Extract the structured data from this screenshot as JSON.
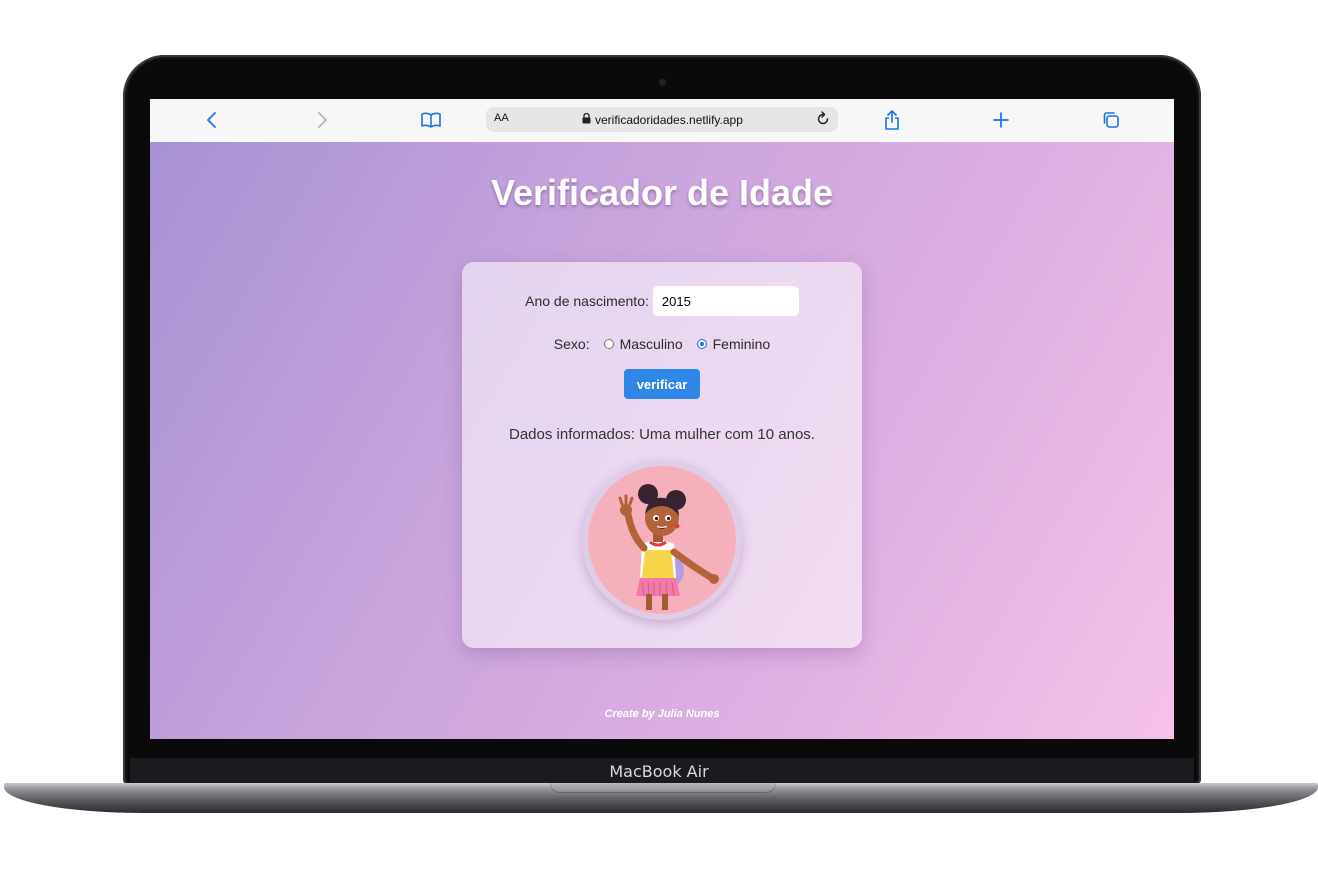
{
  "device": {
    "label": "MacBook Air"
  },
  "browser": {
    "text_size_label": "AA",
    "url": "verificadoridades.netlify.app",
    "icons": [
      "back-icon",
      "forward-icon",
      "bookmarks-icon",
      "lock-icon",
      "reload-icon",
      "share-icon",
      "new-tab-icon",
      "tabs-icon"
    ],
    "accent": "#1a73e8"
  },
  "page": {
    "title": "Verificador de Idade",
    "form": {
      "year_label": "Ano de nascimento:",
      "year_value": "2015",
      "sex_label": "Sexo:",
      "options": [
        {
          "label": "Masculino",
          "checked": false
        },
        {
          "label": "Feminino",
          "checked": true
        }
      ],
      "submit_label": "verificar"
    },
    "result": "Dados informados: Uma mulher com 10 anos.",
    "image": {
      "subject": "girl-illustration"
    },
    "footer": "Create by Julia Nunes",
    "colors": {
      "gradient_start": "#a792d4",
      "gradient_end": "#f6c2e8",
      "button": "#2f86e6"
    }
  }
}
